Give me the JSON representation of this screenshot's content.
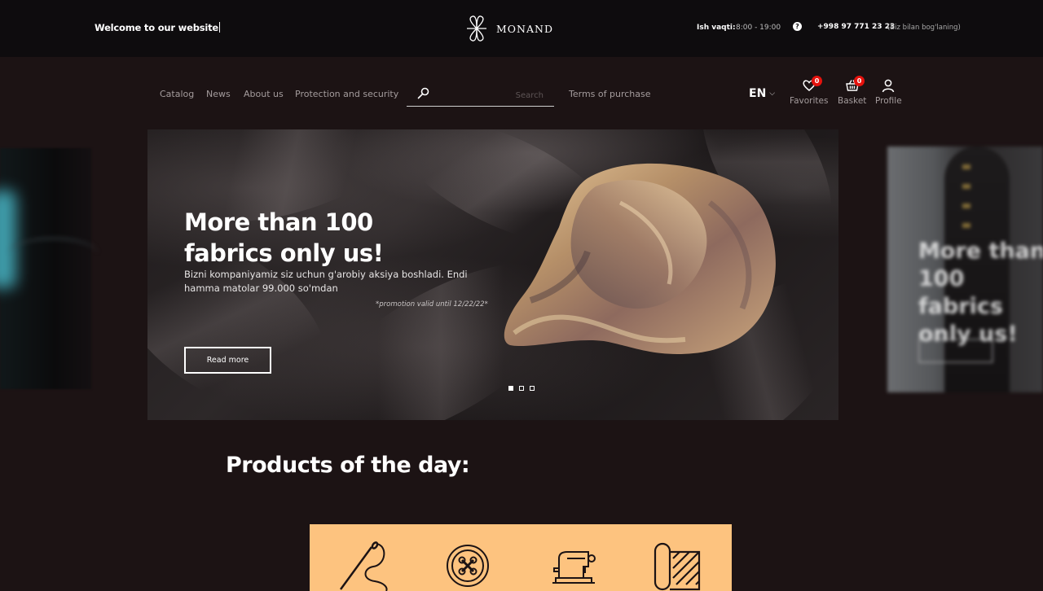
{
  "topbar": {
    "welcome": "Welcome to our website",
    "brand": "MONAND",
    "hours_label": "Ish vaqti:",
    "hours_value": "8:00 - 19:00",
    "help_glyph": "?",
    "phone": "+998 97 771 23 23",
    "contact_note": "(Biz bilan bog'laning)"
  },
  "nav": {
    "links": [
      "Catalog",
      "News",
      "About us",
      "Protection and security"
    ],
    "search_placeholder": "Search",
    "terms": "Terms of purchase",
    "lang": "EN",
    "lang_chevron": "⌵",
    "favorites": {
      "label": "Favorites",
      "count": "0"
    },
    "basket": {
      "label": "Basket",
      "count": "0"
    },
    "profile": {
      "label": "Profile"
    }
  },
  "hero": {
    "title": "More than 100 fabrics only us!",
    "description": "Bizni kompaniyamiz siz uchun g'arobiy aksiya boshladi. Endi hamma matolar 99.000 so'mdan",
    "note": "*promotion valid until 12/22/22*",
    "button": "Read more",
    "slides": 3,
    "active_slide": 1
  },
  "products": {
    "title": "Products of the day:",
    "strip_color": "#fdc37f",
    "icons": [
      "needle-thread-icon",
      "button-icon",
      "sewing-machine-icon",
      "fabric-roll-icon"
    ]
  },
  "colors": {
    "background": "#1c1314",
    "topbar": "#0e0c0e",
    "badge": "#e5120d"
  }
}
